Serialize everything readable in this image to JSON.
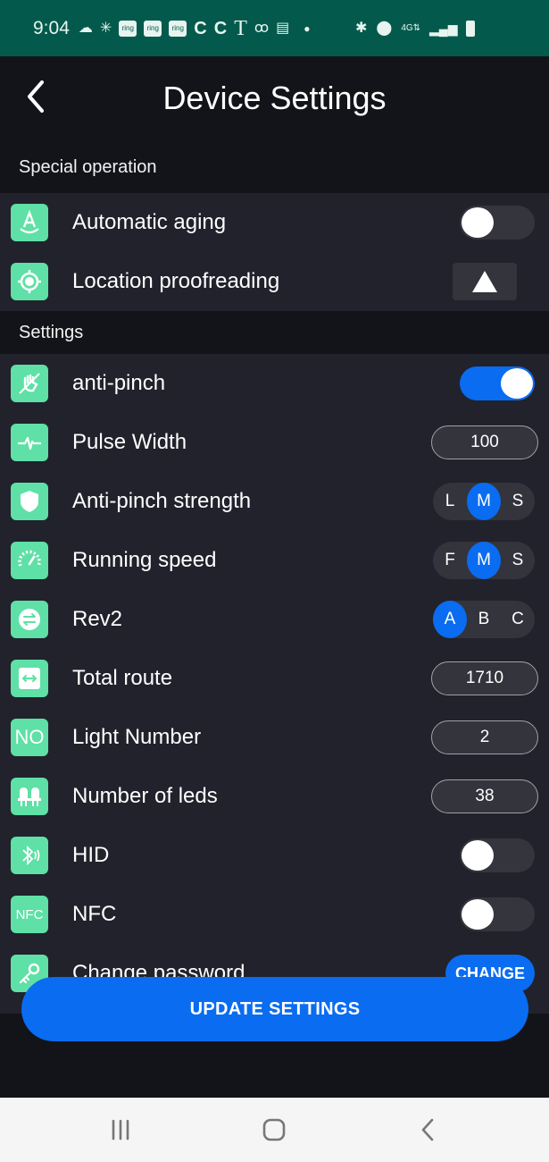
{
  "status_bar": {
    "time": "9:04",
    "left_icons": [
      "cloud-icon",
      "loading-icon",
      "ring-icon",
      "ring-icon",
      "ring-icon",
      "c-app-icon",
      "c-app-icon",
      "tmobile-icon",
      "voicemail-icon",
      "wallet-icon",
      "dot-icon"
    ],
    "ring_label": "ring",
    "right_icons": [
      "bluetooth-icon",
      "location-icon",
      "4g-lte-icon",
      "signal-icon",
      "battery-icon"
    ]
  },
  "header": {
    "title": "Device Settings",
    "back_icon": "chevron-left-icon"
  },
  "sections": [
    {
      "label": "Special operation",
      "items": [
        {
          "label": "Automatic aging",
          "icon": "aging-icon",
          "control": "toggle",
          "value": false
        },
        {
          "label": "Location proofreading",
          "icon": "target-icon",
          "control": "triangle-button"
        }
      ]
    },
    {
      "label": "Settings",
      "items": [
        {
          "label": "anti-pinch",
          "icon": "no-hand-icon",
          "control": "toggle",
          "value": true
        },
        {
          "label": "Pulse Width",
          "icon": "pulse-icon",
          "control": "input",
          "value": "100"
        },
        {
          "label": "Anti-pinch strength",
          "icon": "shield-icon",
          "control": "segmented",
          "options": [
            "L",
            "M",
            "S"
          ],
          "selected": "M"
        },
        {
          "label": "Running speed",
          "icon": "speedometer-icon",
          "control": "segmented",
          "options": [
            "F",
            "M",
            "S"
          ],
          "selected": "M"
        },
        {
          "label": "Rev2",
          "icon": "swap-icon",
          "control": "segmented",
          "options": [
            "A",
            "B",
            "C"
          ],
          "selected": "A"
        },
        {
          "label": "Total route",
          "icon": "width-arrows-icon",
          "control": "input",
          "value": "1710"
        },
        {
          "label": "Light Number",
          "icon": "number-icon",
          "icon_text": "NO",
          "control": "input",
          "value": "2"
        },
        {
          "label": "Number of leds",
          "icon": "leds-icon",
          "control": "input",
          "value": "38"
        },
        {
          "label": "HID",
          "icon": "bluetooth-audio-icon",
          "control": "toggle",
          "value": false
        },
        {
          "label": "NFC",
          "icon": "nfc-icon",
          "icon_text": "NFC",
          "control": "toggle",
          "value": false
        },
        {
          "label": "Change password",
          "icon": "key-icon",
          "control": "button",
          "button_label": "CHANGE"
        }
      ]
    }
  ],
  "footer": {
    "update_label": "UPDATE SETTINGS"
  },
  "nav_bar": {
    "items": [
      "recent-apps-icon",
      "home-icon",
      "back-icon"
    ]
  },
  "colors": {
    "accent": "#0a6cf0",
    "icon_bg": "#5ee0a6",
    "status_bar": "#035a4c",
    "row_bg": "#21222c"
  }
}
